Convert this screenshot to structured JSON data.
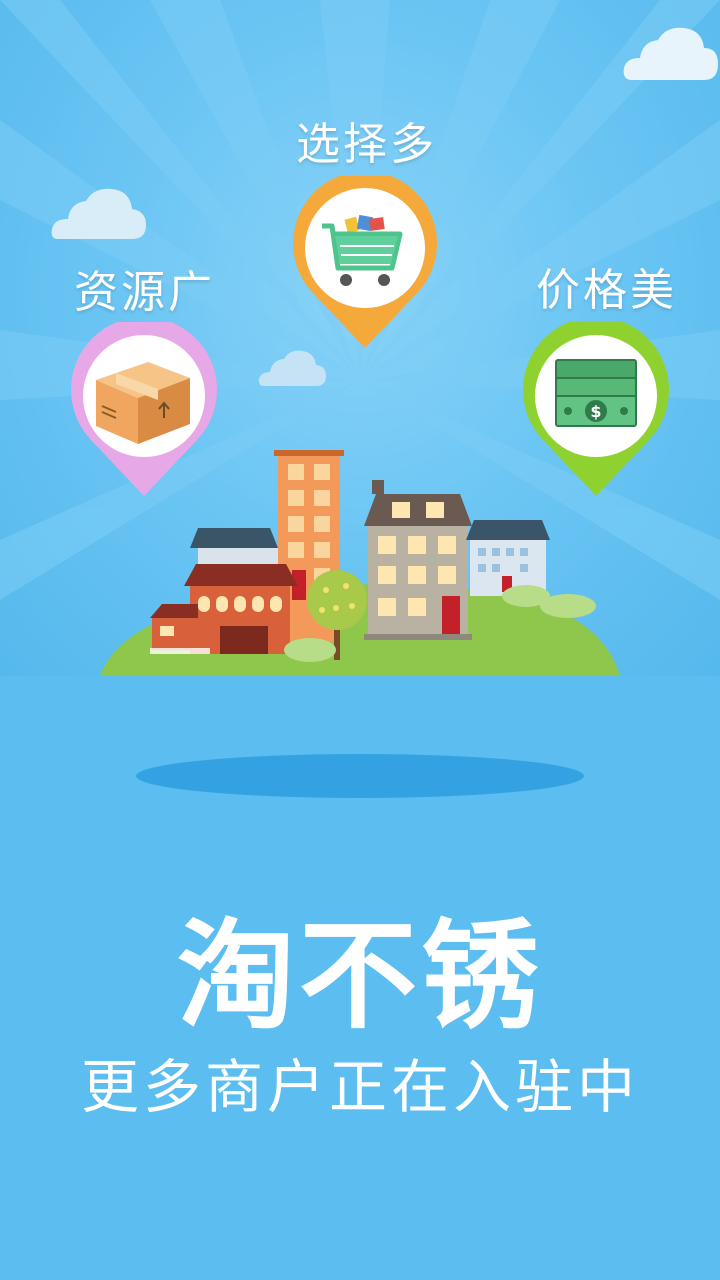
{
  "features": {
    "left": {
      "label": "资源广",
      "icon": "package-box-icon",
      "color": "#e4a6e4"
    },
    "center": {
      "label": "选择多",
      "icon": "shopping-cart-icon",
      "color": "#f5a93a"
    },
    "right": {
      "label": "价格美",
      "icon": "money-bills-icon",
      "color": "#8fd230"
    }
  },
  "brand": {
    "name": "淘不锈"
  },
  "tagline": "更多商户正在入驻中",
  "colors": {
    "sky": "#6cc6f4",
    "background": "#5bbdf0",
    "island": "#8fc74c"
  }
}
